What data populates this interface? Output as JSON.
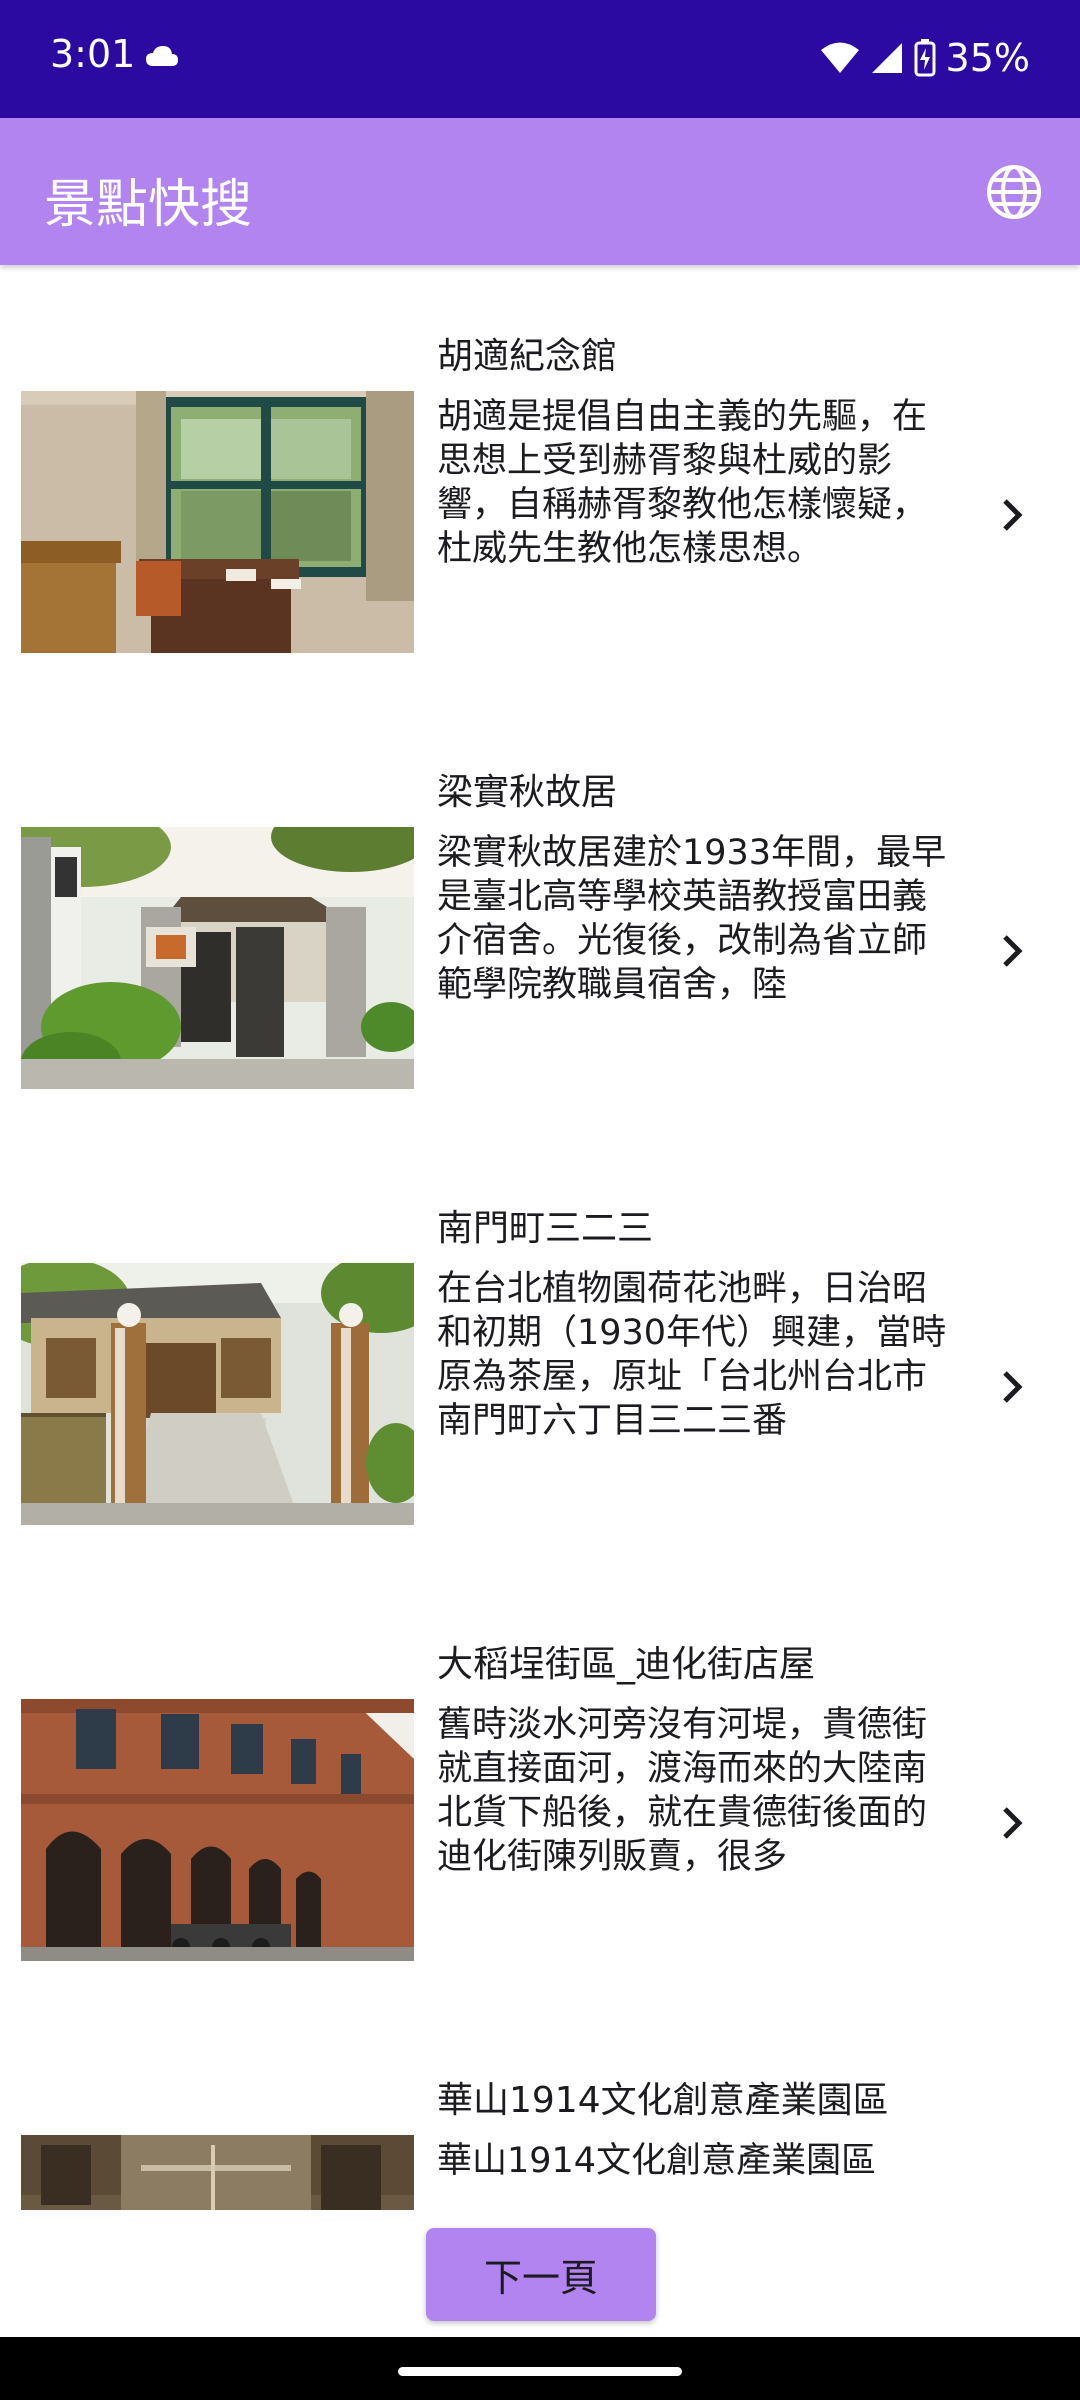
{
  "status": {
    "time": "3:01",
    "battery": "35%",
    "icons": [
      "cloud-icon",
      "wifi-icon",
      "signal-icon",
      "battery-icon"
    ]
  },
  "app_bar": {
    "title": "景點快搜",
    "action_icon": "globe-icon"
  },
  "items": [
    {
      "title": "胡適紀念館",
      "description": "胡適是提倡自由主義的先驅，在思想上受到赫胥黎與杜威的影響，自稱赫胥黎教他怎樣懷疑，杜威先生教他怎樣思想。",
      "image": "interior-room-photo"
    },
    {
      "title": "梁實秋故居",
      "description": "梁實秋故居建於1933年間，最早是臺北高等學校英語教授富田義介宿舍。光復後，改制為省立師範學院教職員宿舍，陸",
      "image": "house-gate-photo"
    },
    {
      "title": "南門町三二三",
      "description": "在台北植物園荷花池畔，日治昭和初期（1930年代）興建，當時原為茶屋，原址「台北州台北市南門町六丁目三二三番",
      "image": "gate-pillars-photo"
    },
    {
      "title": "大稻埕街區_迪化街店屋",
      "description": "舊時淡水河旁沒有河堤，貴德街就直接面河，渡海而來的大陸南北貨下船後，就在貴德街後面的迪化街陳列販賣，很多",
      "image": "brick-arcade-photo"
    },
    {
      "title": "華山1914文化創意產業園區",
      "description": "華山1914文化創意產業園區",
      "image": "warehouse-interior-photo"
    }
  ],
  "next_button": "下一頁",
  "colors": {
    "status_bar": "#2a0aa0",
    "app_bar": "#b284f0",
    "button": "#b284f0"
  }
}
